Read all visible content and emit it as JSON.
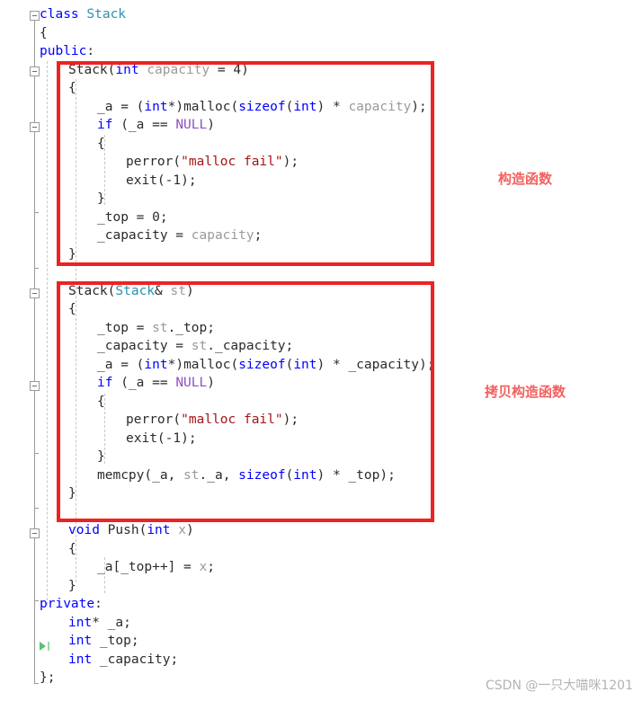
{
  "editor": {
    "language": "cpp",
    "background_color": "#ffffff",
    "colors": {
      "keyword": "#0000ff",
      "type_name": "#2b91af",
      "macro": "#8f4fbf",
      "string": "#a31515",
      "parameter": "#9a9a9a",
      "plain": "#2b2b2b",
      "highlight_box": "#ee2222",
      "annotation_text": "#f2605f",
      "watermark": "#b3b3b3",
      "gutter_line": "#9a9a9a",
      "indent_guide": "#c8c8c8",
      "run_marker": "#58c26b"
    },
    "lines": [
      {
        "n": 1,
        "indent": 0,
        "tokens": [
          {
            "t": "class",
            "c": "kw"
          },
          {
            "t": " ",
            "c": "pln"
          },
          {
            "t": "Stack",
            "c": "type"
          }
        ]
      },
      {
        "n": 2,
        "indent": 0,
        "tokens": [
          {
            "t": "{",
            "c": "pln"
          }
        ]
      },
      {
        "n": 3,
        "indent": 0,
        "tokens": [
          {
            "t": "public",
            "c": "kw"
          },
          {
            "t": ":",
            "c": "pln"
          }
        ]
      },
      {
        "n": 4,
        "indent": 1,
        "tokens": [
          {
            "t": "Stack",
            "c": "pln"
          },
          {
            "t": "(",
            "c": "pln"
          },
          {
            "t": "int",
            "c": "kw"
          },
          {
            "t": " ",
            "c": "pln"
          },
          {
            "t": "capacity",
            "c": "par"
          },
          {
            "t": " = ",
            "c": "pln"
          },
          {
            "t": "4",
            "c": "num"
          },
          {
            "t": ")",
            "c": "pln"
          }
        ]
      },
      {
        "n": 5,
        "indent": 1,
        "tokens": [
          {
            "t": "{",
            "c": "pln"
          }
        ]
      },
      {
        "n": 6,
        "indent": 2,
        "tokens": [
          {
            "t": "_a = (",
            "c": "pln"
          },
          {
            "t": "int",
            "c": "kw"
          },
          {
            "t": "*)",
            "c": "pln"
          },
          {
            "t": "malloc",
            "c": "pln"
          },
          {
            "t": "(",
            "c": "pln"
          },
          {
            "t": "sizeof",
            "c": "kw"
          },
          {
            "t": "(",
            "c": "pln"
          },
          {
            "t": "int",
            "c": "kw"
          },
          {
            "t": ") * ",
            "c": "pln"
          },
          {
            "t": "capacity",
            "c": "par"
          },
          {
            "t": ");",
            "c": "pln"
          }
        ]
      },
      {
        "n": 7,
        "indent": 2,
        "tokens": [
          {
            "t": "if",
            "c": "kw"
          },
          {
            "t": " (_a == ",
            "c": "pln"
          },
          {
            "t": "NULL",
            "c": "mac"
          },
          {
            "t": ")",
            "c": "pln"
          }
        ]
      },
      {
        "n": 8,
        "indent": 2,
        "tokens": [
          {
            "t": "{",
            "c": "pln"
          }
        ]
      },
      {
        "n": 9,
        "indent": 3,
        "tokens": [
          {
            "t": "perror",
            "c": "pln"
          },
          {
            "t": "(",
            "c": "pln"
          },
          {
            "t": "\"malloc fail\"",
            "c": "str"
          },
          {
            "t": ");",
            "c": "pln"
          }
        ]
      },
      {
        "n": 10,
        "indent": 3,
        "tokens": [
          {
            "t": "exit",
            "c": "pln"
          },
          {
            "t": "(-",
            "c": "pln"
          },
          {
            "t": "1",
            "c": "num"
          },
          {
            "t": ");",
            "c": "pln"
          }
        ]
      },
      {
        "n": 11,
        "indent": 2,
        "tokens": [
          {
            "t": "}",
            "c": "pln"
          }
        ]
      },
      {
        "n": 12,
        "indent": 2,
        "tokens": [
          {
            "t": "_top = ",
            "c": "pln"
          },
          {
            "t": "0",
            "c": "num"
          },
          {
            "t": ";",
            "c": "pln"
          }
        ]
      },
      {
        "n": 13,
        "indent": 2,
        "tokens": [
          {
            "t": "_capacity = ",
            "c": "pln"
          },
          {
            "t": "capacity",
            "c": "par"
          },
          {
            "t": ";",
            "c": "pln"
          }
        ]
      },
      {
        "n": 14,
        "indent": 1,
        "tokens": [
          {
            "t": "}",
            "c": "pln"
          }
        ]
      },
      {
        "n": 15,
        "indent": 0,
        "tokens": [
          {
            "t": "",
            "c": "pln"
          }
        ]
      },
      {
        "n": 16,
        "indent": 1,
        "tokens": [
          {
            "t": "Stack",
            "c": "pln"
          },
          {
            "t": "(",
            "c": "pln"
          },
          {
            "t": "Stack",
            "c": "type"
          },
          {
            "t": "& ",
            "c": "pln"
          },
          {
            "t": "st",
            "c": "par"
          },
          {
            "t": ")",
            "c": "pln"
          }
        ]
      },
      {
        "n": 17,
        "indent": 1,
        "tokens": [
          {
            "t": "{",
            "c": "pln"
          }
        ]
      },
      {
        "n": 18,
        "indent": 2,
        "tokens": [
          {
            "t": "_top = ",
            "c": "pln"
          },
          {
            "t": "st",
            "c": "par"
          },
          {
            "t": "._top;",
            "c": "pln"
          }
        ]
      },
      {
        "n": 19,
        "indent": 2,
        "tokens": [
          {
            "t": "_capacity = ",
            "c": "pln"
          },
          {
            "t": "st",
            "c": "par"
          },
          {
            "t": "._capacity;",
            "c": "pln"
          }
        ]
      },
      {
        "n": 20,
        "indent": 2,
        "tokens": [
          {
            "t": "_a = (",
            "c": "pln"
          },
          {
            "t": "int",
            "c": "kw"
          },
          {
            "t": "*)",
            "c": "pln"
          },
          {
            "t": "malloc",
            "c": "pln"
          },
          {
            "t": "(",
            "c": "pln"
          },
          {
            "t": "sizeof",
            "c": "kw"
          },
          {
            "t": "(",
            "c": "pln"
          },
          {
            "t": "int",
            "c": "kw"
          },
          {
            "t": ") * _capacity);",
            "c": "pln"
          }
        ]
      },
      {
        "n": 21,
        "indent": 2,
        "tokens": [
          {
            "t": "if",
            "c": "kw"
          },
          {
            "t": " (_a == ",
            "c": "pln"
          },
          {
            "t": "NULL",
            "c": "mac"
          },
          {
            "t": ")",
            "c": "pln"
          }
        ]
      },
      {
        "n": 22,
        "indent": 2,
        "tokens": [
          {
            "t": "{",
            "c": "pln"
          }
        ]
      },
      {
        "n": 23,
        "indent": 3,
        "tokens": [
          {
            "t": "perror",
            "c": "pln"
          },
          {
            "t": "(",
            "c": "pln"
          },
          {
            "t": "\"malloc fail\"",
            "c": "str"
          },
          {
            "t": ");",
            "c": "pln"
          }
        ]
      },
      {
        "n": 24,
        "indent": 3,
        "tokens": [
          {
            "t": "exit",
            "c": "pln"
          },
          {
            "t": "(-",
            "c": "pln"
          },
          {
            "t": "1",
            "c": "num"
          },
          {
            "t": ");",
            "c": "pln"
          }
        ]
      },
      {
        "n": 25,
        "indent": 2,
        "tokens": [
          {
            "t": "}",
            "c": "pln"
          }
        ]
      },
      {
        "n": 26,
        "indent": 2,
        "tokens": [
          {
            "t": "memcpy",
            "c": "pln"
          },
          {
            "t": "(_a, ",
            "c": "pln"
          },
          {
            "t": "st",
            "c": "par"
          },
          {
            "t": "._a, ",
            "c": "pln"
          },
          {
            "t": "sizeof",
            "c": "kw"
          },
          {
            "t": "(",
            "c": "pln"
          },
          {
            "t": "int",
            "c": "kw"
          },
          {
            "t": ") * _top);",
            "c": "pln"
          }
        ]
      },
      {
        "n": 27,
        "indent": 1,
        "tokens": [
          {
            "t": "}",
            "c": "pln"
          }
        ]
      },
      {
        "n": 28,
        "indent": 0,
        "tokens": [
          {
            "t": "",
            "c": "pln"
          }
        ]
      },
      {
        "n": 29,
        "indent": 1,
        "tokens": [
          {
            "t": "void",
            "c": "kw"
          },
          {
            "t": " ",
            "c": "pln"
          },
          {
            "t": "Push",
            "c": "pln"
          },
          {
            "t": "(",
            "c": "pln"
          },
          {
            "t": "int",
            "c": "kw"
          },
          {
            "t": " ",
            "c": "pln"
          },
          {
            "t": "x",
            "c": "par"
          },
          {
            "t": ")",
            "c": "pln"
          }
        ]
      },
      {
        "n": 30,
        "indent": 1,
        "tokens": [
          {
            "t": "{",
            "c": "pln"
          }
        ]
      },
      {
        "n": 31,
        "indent": 2,
        "tokens": [
          {
            "t": "_a[_top++] = ",
            "c": "pln"
          },
          {
            "t": "x",
            "c": "par"
          },
          {
            "t": ";",
            "c": "pln"
          }
        ]
      },
      {
        "n": 32,
        "indent": 1,
        "tokens": [
          {
            "t": "}",
            "c": "pln"
          }
        ]
      },
      {
        "n": 33,
        "indent": 0,
        "tokens": [
          {
            "t": "private",
            "c": "kw"
          },
          {
            "t": ":",
            "c": "pln"
          }
        ]
      },
      {
        "n": 34,
        "indent": 1,
        "tokens": [
          {
            "t": "int",
            "c": "kw"
          },
          {
            "t": "* _a;",
            "c": "pln"
          }
        ]
      },
      {
        "n": 35,
        "indent": 1,
        "tokens": [
          {
            "t": "int",
            "c": "kw"
          },
          {
            "t": " _top;",
            "c": "pln"
          }
        ]
      },
      {
        "n": 36,
        "indent": 1,
        "tokens": [
          {
            "t": "int",
            "c": "kw"
          },
          {
            "t": " _capacity;",
            "c": "pln"
          }
        ]
      },
      {
        "n": 37,
        "indent": 0,
        "tokens": [
          {
            "t": "};",
            "c": "pln"
          }
        ]
      }
    ]
  },
  "gutter": {
    "fold_markers": [
      {
        "name": "fold-class-stack",
        "line": 1
      },
      {
        "name": "fold-constructor",
        "line": 4
      },
      {
        "name": "fold-if-null-1",
        "line": 7
      },
      {
        "name": "fold-copy-constructor",
        "line": 16
      },
      {
        "name": "fold-if-null-2",
        "line": 21
      },
      {
        "name": "fold-push",
        "line": 29
      }
    ],
    "run_marker": {
      "name": "run-to-cursor-marker",
      "line": 35
    }
  },
  "annotations": {
    "boxes": [
      {
        "name": "constructor-highlight-box",
        "label": "constructor block"
      },
      {
        "name": "copy-constructor-highlight-box",
        "label": "copy constructor block"
      }
    ],
    "labels": [
      {
        "name": "constructor-annotation",
        "text": "构造函数"
      },
      {
        "name": "copy-constructor-annotation",
        "text": "拷贝构造函数"
      }
    ]
  },
  "watermark": {
    "text": "CSDN @一只大喵咪1201"
  }
}
